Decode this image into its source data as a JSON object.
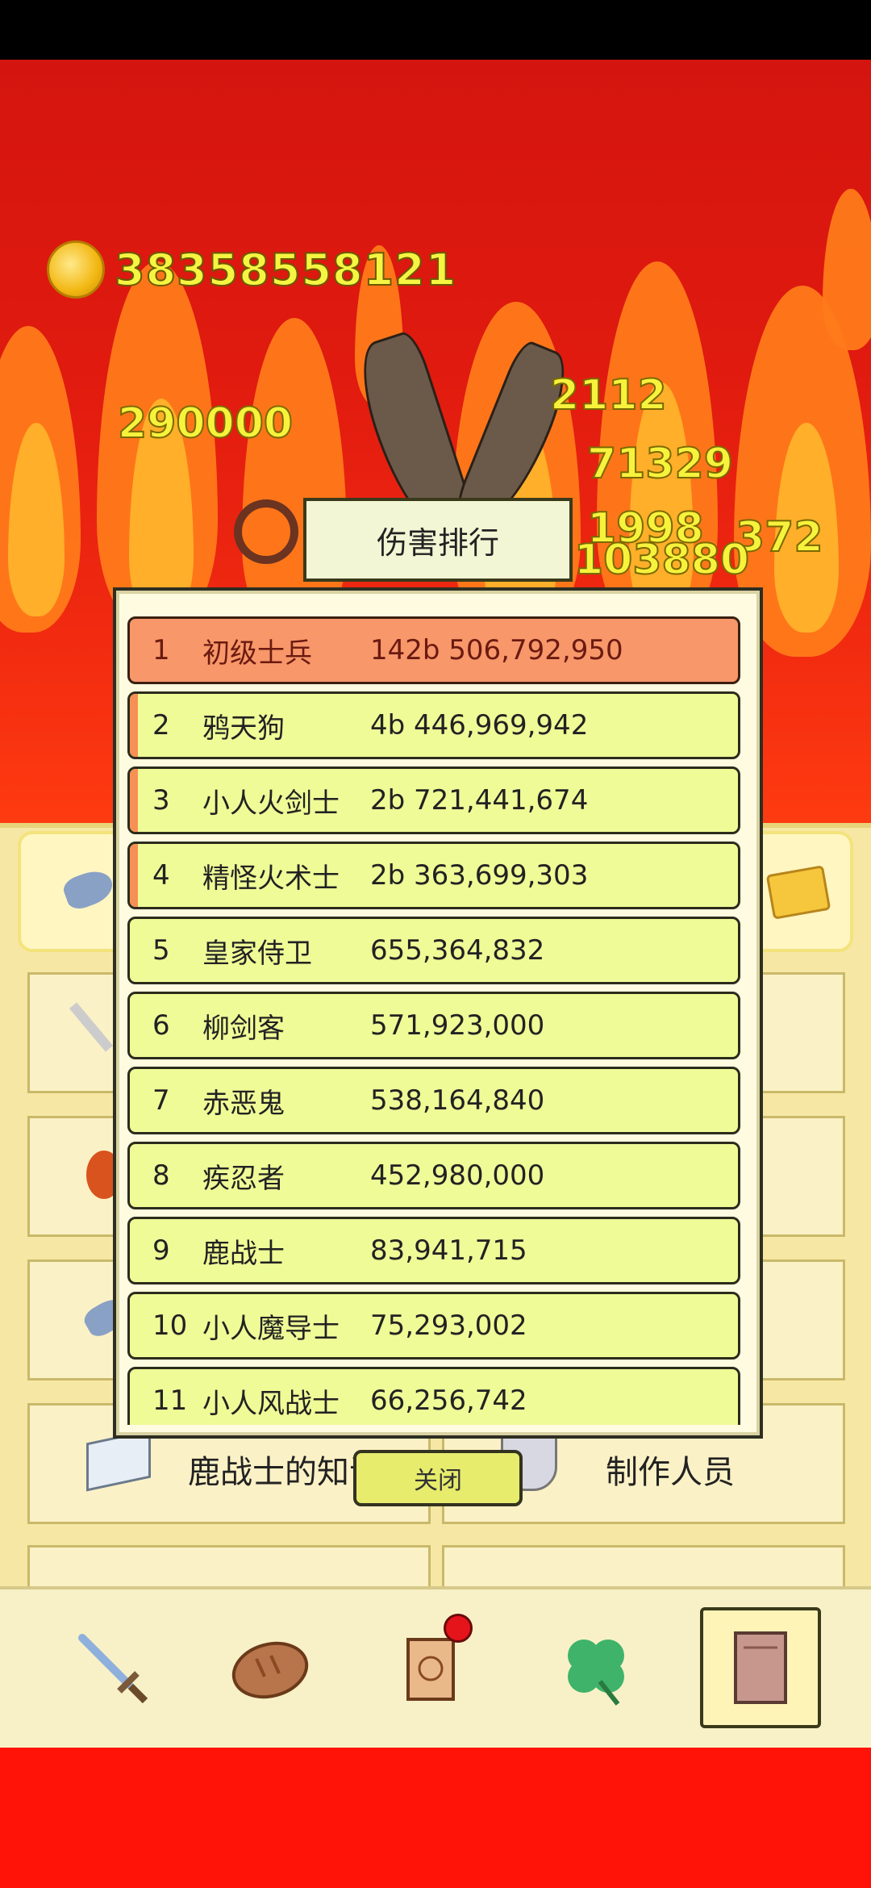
{
  "hud": {
    "gold": "38358558121",
    "damage_numbers": [
      "290000",
      "2112",
      "71329",
      "1998",
      "372",
      "103880"
    ]
  },
  "ranking": {
    "title": "伤害排行",
    "rows": [
      {
        "rank": "1",
        "name": "初级士兵",
        "score": "142b 506,792,950"
      },
      {
        "rank": "2",
        "name": "鸦天狗",
        "score": "4b 446,969,942"
      },
      {
        "rank": "3",
        "name": "小人火剑士",
        "score": "2b 721,441,674"
      },
      {
        "rank": "4",
        "name": "精怪火术士",
        "score": "2b 363,699,303"
      },
      {
        "rank": "5",
        "name": "皇家侍卫",
        "score": "655,364,832"
      },
      {
        "rank": "6",
        "name": "柳剑客",
        "score": "571,923,000"
      },
      {
        "rank": "7",
        "name": "赤恶鬼",
        "score": "538,164,840"
      },
      {
        "rank": "8",
        "name": "疾忍者",
        "score": "452,980,000"
      },
      {
        "rank": "9",
        "name": "鹿战士",
        "score": "83,941,715"
      },
      {
        "rank": "10",
        "name": "小人魔导士",
        "score": "75,293,002"
      },
      {
        "rank": "11",
        "name": "小人风战士",
        "score": "66,256,742"
      }
    ],
    "close_label": "关闭"
  },
  "menu": {
    "left_label": "鹿战士的知识",
    "right_label": "制作人员"
  },
  "bottom_nav": {
    "items": [
      "sword-icon",
      "bread-icon",
      "scroll-icon",
      "clover-icon",
      "book-icon"
    ],
    "selected": "book-icon",
    "notification_on": "scroll-icon"
  },
  "colors": {
    "sky_top": "#d4150f",
    "flame_orange": "#ff7a1a",
    "flame_yellow": "#ffb22a",
    "row_bg": "#eefb97",
    "row_top1_bg": "#f7976a",
    "damage_text": "#f7f23c"
  }
}
